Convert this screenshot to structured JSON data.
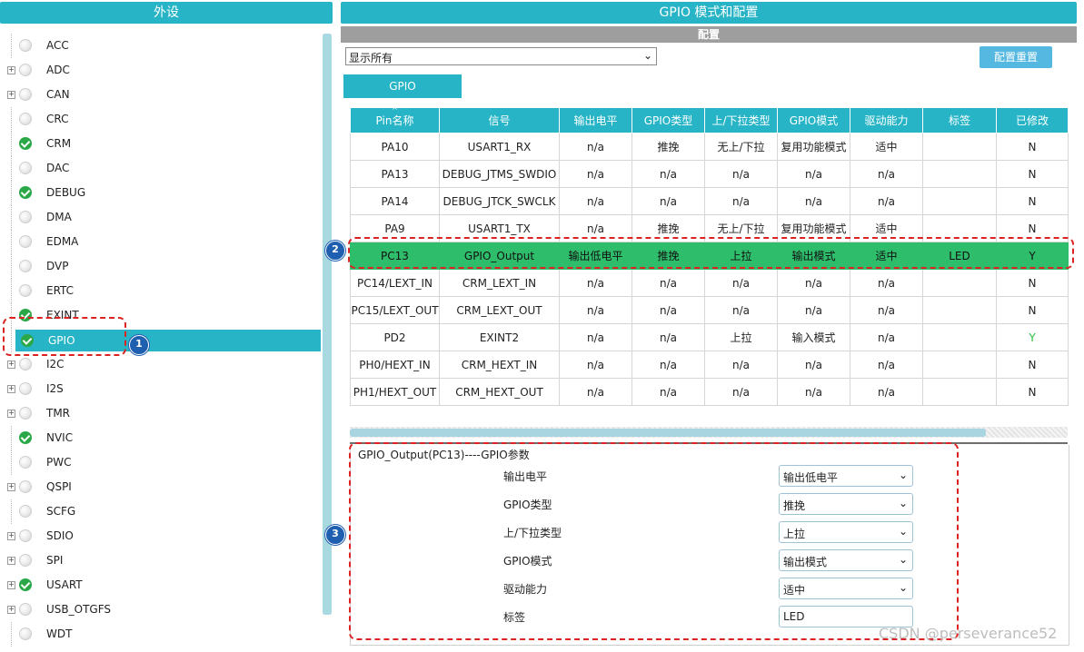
{
  "left_panel": {
    "title": "外设",
    "items": [
      {
        "label": "ACC",
        "enabled": false,
        "expandable": false
      },
      {
        "label": "ADC",
        "enabled": false,
        "expandable": true
      },
      {
        "label": "CAN",
        "enabled": false,
        "expandable": true
      },
      {
        "label": "CRC",
        "enabled": false,
        "expandable": false
      },
      {
        "label": "CRM",
        "enabled": true,
        "expandable": false
      },
      {
        "label": "DAC",
        "enabled": false,
        "expandable": false
      },
      {
        "label": "DEBUG",
        "enabled": true,
        "expandable": false
      },
      {
        "label": "DMA",
        "enabled": false,
        "expandable": false
      },
      {
        "label": "EDMA",
        "enabled": false,
        "expandable": false
      },
      {
        "label": "DVP",
        "enabled": false,
        "expandable": false
      },
      {
        "label": "ERTC",
        "enabled": false,
        "expandable": false
      },
      {
        "label": "EXINT",
        "enabled": true,
        "expandable": false
      },
      {
        "label": "GPIO",
        "enabled": true,
        "expandable": false,
        "selected": true
      },
      {
        "label": "I2C",
        "enabled": false,
        "expandable": true
      },
      {
        "label": "I2S",
        "enabled": false,
        "expandable": true
      },
      {
        "label": "TMR",
        "enabled": false,
        "expandable": true
      },
      {
        "label": "NVIC",
        "enabled": true,
        "expandable": false
      },
      {
        "label": "PWC",
        "enabled": false,
        "expandable": false
      },
      {
        "label": "QSPI",
        "enabled": false,
        "expandable": true
      },
      {
        "label": "SCFG",
        "enabled": false,
        "expandable": false
      },
      {
        "label": "SDIO",
        "enabled": false,
        "expandable": true
      },
      {
        "label": "SPI",
        "enabled": false,
        "expandable": true
      },
      {
        "label": "USART",
        "enabled": true,
        "expandable": true
      },
      {
        "label": "USB_OTGFS",
        "enabled": false,
        "expandable": true
      },
      {
        "label": "WDT",
        "enabled": false,
        "expandable": false
      }
    ]
  },
  "right_panel": {
    "title": "GPIO 模式和配置",
    "config_bar": "配置",
    "filter": {
      "value": "显示所有"
    },
    "reset_button": "配置重置",
    "tab": "GPIO",
    "table": {
      "columns": [
        "Pin名称",
        "信号",
        "输出电平",
        "GPIO类型",
        "上/下拉类型",
        "GPIO模式",
        "驱动能力",
        "标签",
        "已修改"
      ],
      "rows": [
        [
          "PA10",
          "USART1_RX",
          "n/a",
          "推挽",
          "无上/下拉",
          "复用功能模式",
          "适中",
          "",
          "N"
        ],
        [
          "PA13",
          "DEBUG_JTMS_SWDIO",
          "n/a",
          "n/a",
          "n/a",
          "n/a",
          "n/a",
          "",
          "N"
        ],
        [
          "PA14",
          "DEBUG_JTCK_SWCLK",
          "n/a",
          "n/a",
          "n/a",
          "n/a",
          "n/a",
          "",
          "N"
        ],
        [
          "PA9",
          "USART1_TX",
          "n/a",
          "推挽",
          "无上/下拉",
          "复用功能模式",
          "适中",
          "",
          "N"
        ],
        [
          "PC13",
          "GPIO_Output",
          "输出低电平",
          "推挽",
          "上拉",
          "输出模式",
          "适中",
          "LED",
          "Y"
        ],
        [
          "PC14/LEXT_IN",
          "CRM_LEXT_IN",
          "n/a",
          "n/a",
          "n/a",
          "n/a",
          "n/a",
          "",
          "N"
        ],
        [
          "PC15/LEXT_OUT",
          "CRM_LEXT_OUT",
          "n/a",
          "n/a",
          "n/a",
          "n/a",
          "n/a",
          "",
          "N"
        ],
        [
          "PD2",
          "EXINT2",
          "n/a",
          "n/a",
          "上拉",
          "输入模式",
          "n/a",
          "",
          "Y"
        ],
        [
          "PH0/HEXT_IN",
          "CRM_HEXT_IN",
          "n/a",
          "n/a",
          "n/a",
          "n/a",
          "n/a",
          "",
          "N"
        ],
        [
          "PH1/HEXT_OUT",
          "CRM_HEXT_OUT",
          "n/a",
          "n/a",
          "n/a",
          "n/a",
          "n/a",
          "",
          "N"
        ]
      ],
      "highlighted_row": 4
    },
    "params": {
      "title": "GPIO_Output(PC13)----GPIO参数",
      "fields": [
        {
          "label": "输出电平",
          "value": "输出低电平",
          "type": "select"
        },
        {
          "label": "GPIO类型",
          "value": "推挽",
          "type": "select"
        },
        {
          "label": "上/下拉类型",
          "value": "上拉",
          "type": "select"
        },
        {
          "label": "GPIO模式",
          "value": "输出模式",
          "type": "select"
        },
        {
          "label": "驱动能力",
          "value": "适中",
          "type": "select"
        },
        {
          "label": "标签",
          "value": "LED",
          "type": "input"
        }
      ]
    }
  },
  "annotations": {
    "callout_1": "1",
    "callout_2": "2",
    "callout_3": "3"
  },
  "watermark": "CSDN @perseverance52",
  "colors": {
    "accent": "#26b4c6",
    "highlight_row": "#2ebd6b",
    "enabled_status": "#2aa847",
    "callout": "#1f5fb0",
    "annotation_red": "#dd2222"
  }
}
